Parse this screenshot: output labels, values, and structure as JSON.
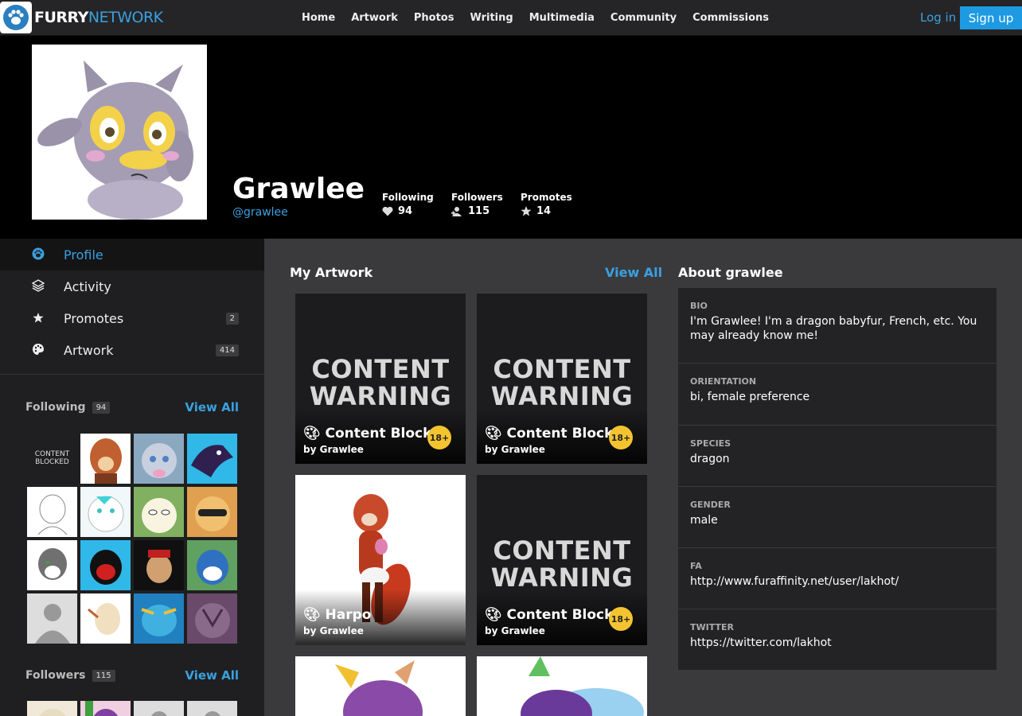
{
  "logo": {
    "part1": "FURRY",
    "part2": "NETWORK"
  },
  "nav": [
    "Home",
    "Artwork",
    "Photos",
    "Writing",
    "Multimedia",
    "Community",
    "Commissions"
  ],
  "auth": {
    "login": "Log in",
    "signup": "Sign up"
  },
  "profile": {
    "name": "Grawlee",
    "handle": "@grawlee",
    "stats": [
      {
        "label": "Following",
        "value": "94",
        "icon": "heart-icon"
      },
      {
        "label": "Followers",
        "value": "115",
        "icon": "user-plus-icon"
      },
      {
        "label": "Promotes",
        "value": "14",
        "icon": "star-icon"
      }
    ]
  },
  "sidebar": {
    "items": [
      {
        "label": "Profile",
        "icon": "paw-icon",
        "count": ""
      },
      {
        "label": "Activity",
        "icon": "layers-icon",
        "count": ""
      },
      {
        "label": "Promotes",
        "icon": "star-icon",
        "count": "2"
      },
      {
        "label": "Artwork",
        "icon": "palette-icon",
        "count": "414"
      }
    ],
    "following": {
      "title": "Following",
      "count": "94",
      "view_all": "View All",
      "blocked_text": "CONTENT BLOCKED"
    },
    "followers": {
      "title": "Followers",
      "count": "115",
      "view_all": "View All"
    }
  },
  "main": {
    "title": "My Artwork",
    "view_all": "View All",
    "warning_line1": "CONTENT",
    "warning_line2": "WARNING",
    "rating_badge": "18+",
    "cards": [
      {
        "title": "Content Blocked",
        "by": "by Grawlee"
      },
      {
        "title": "Content Blocked",
        "by": "by Grawlee"
      },
      {
        "title": "Harpo",
        "by": "by Grawlee"
      },
      {
        "title": "Content Blocked",
        "by": "by Grawlee"
      }
    ]
  },
  "about": {
    "title": "About grawlee",
    "rows": [
      {
        "key": "BIO",
        "value": "I'm Grawlee! I'm a dragon babyfur, French, etc. You may already know me!"
      },
      {
        "key": "ORIENTATION",
        "value": "bi, female preference"
      },
      {
        "key": "SPECIES",
        "value": "dragon"
      },
      {
        "key": "GENDER",
        "value": "male"
      },
      {
        "key": "FA",
        "value": "http://www.furaffinity.net/user/lakhot/"
      },
      {
        "key": "TWITTER",
        "value": "https://twitter.com/lakhot"
      }
    ]
  },
  "colors": {
    "accent": "#3aa0e0",
    "signup": "#1e9ae2",
    "badge": "#f4c430"
  }
}
